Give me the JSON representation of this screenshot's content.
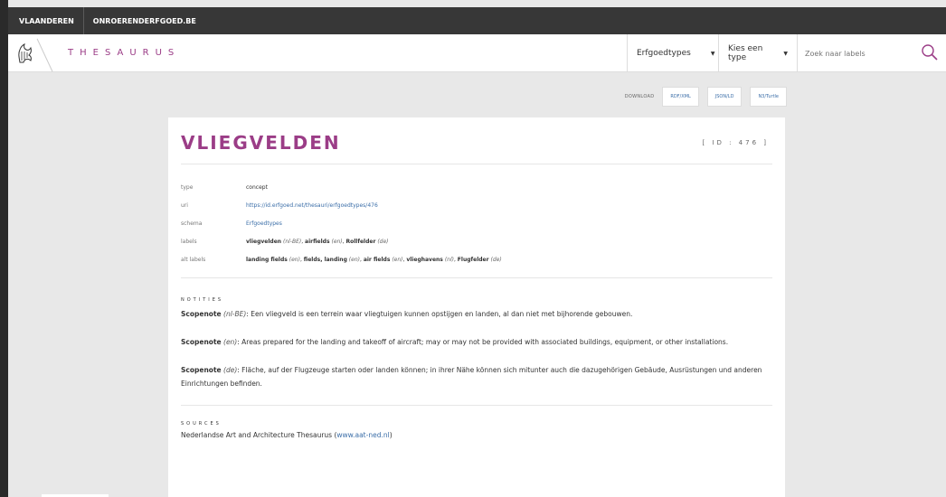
{
  "topbar": {
    "links": [
      "VLAANDEREN",
      "ONROERENDERFGOED.BE"
    ]
  },
  "header": {
    "brand": "THESAURUS",
    "select1": "Erfgoedtypes",
    "select2": "Kies een type",
    "search_placeholder": "Zoek naar labels"
  },
  "download": {
    "label": "DOWNLOAD",
    "buttons": [
      "RDF/XML",
      "JSON/LD",
      "N3/Turtle"
    ]
  },
  "concept": {
    "title": "VLIEGVELDEN",
    "id": "[ ID : 476 ]",
    "props": {
      "type_key": "type",
      "type_val": "concept",
      "uri_key": "uri",
      "uri_val": "https://id.erfgoed.net/thesauri/erfgoedtypes/476",
      "schema_key": "schema",
      "schema_val": "Erfgoedtypes",
      "labels_key": "labels",
      "labels": [
        {
          "text": "vliegvelden",
          "lang": "(nl-BE)"
        },
        {
          "text": "airfields",
          "lang": "(en)"
        },
        {
          "text": "Rollfelder",
          "lang": "(de)"
        }
      ],
      "alt_key": "alt labels",
      "alt_labels": [
        {
          "text": "landing fields",
          "lang": "(en)"
        },
        {
          "text": "fields, landing",
          "lang": "(en)"
        },
        {
          "text": "air fields",
          "lang": "(en)"
        },
        {
          "text": "vlieghavens",
          "lang": "(nl)"
        },
        {
          "text": "Flugfelder",
          "lang": "(de)"
        }
      ]
    }
  },
  "notes": {
    "title": "NOTITIES",
    "items": [
      {
        "label": "Scopenote",
        "lang": "(nl-BE)",
        "text": ": Een vliegveld is een terrein waar vliegtuigen kunnen opstijgen en landen, al dan niet met bijhorende gebouwen."
      },
      {
        "label": "Scopenote",
        "lang": "(en)",
        "text": ": Areas prepared for the landing and takeoff of aircraft; may or may not be provided with associated buildings, equipment, or other installations."
      },
      {
        "label": "Scopenote",
        "lang": "(de)",
        "text": ": Fläche, auf der Flugzeuge starten oder landen können; in ihrer Nähe können sich mitunter auch die dazugehörigen Gebäude, Ausrüstungen und anderen Einrichtungen befinden."
      }
    ]
  },
  "sources": {
    "title": "SOURCES",
    "text_before": "Nederlandse Art and Architecture Thesaurus (",
    "link": "www.aat-ned.nl",
    "text_after": ")"
  },
  "colors": {
    "brand": "#9b3d87",
    "link": "#3b6ea8",
    "topbar": "#373737"
  }
}
